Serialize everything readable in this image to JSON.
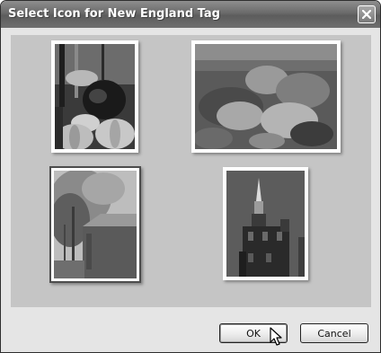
{
  "dialog": {
    "title": "Select Icon for New England Tag"
  },
  "thumbnails": [
    {
      "subject": "pumpkins-and-plants-photo",
      "selected": false
    },
    {
      "subject": "garden-field-photo",
      "selected": false
    },
    {
      "subject": "tree-and-barn-photo",
      "selected": true
    },
    {
      "subject": "church-steeple-tower-photo",
      "selected": false
    }
  ],
  "buttons": {
    "ok_label": "OK",
    "cancel_label": "Cancel"
  },
  "icons": {
    "close": "close-icon",
    "cursor": "mouse-pointer-icon"
  },
  "colors": {
    "titlebar": "#6a6a6a",
    "panel": "#c5c5c5",
    "dialog_background": "#e5e5e5",
    "selection_border": "#4d4d4d"
  }
}
